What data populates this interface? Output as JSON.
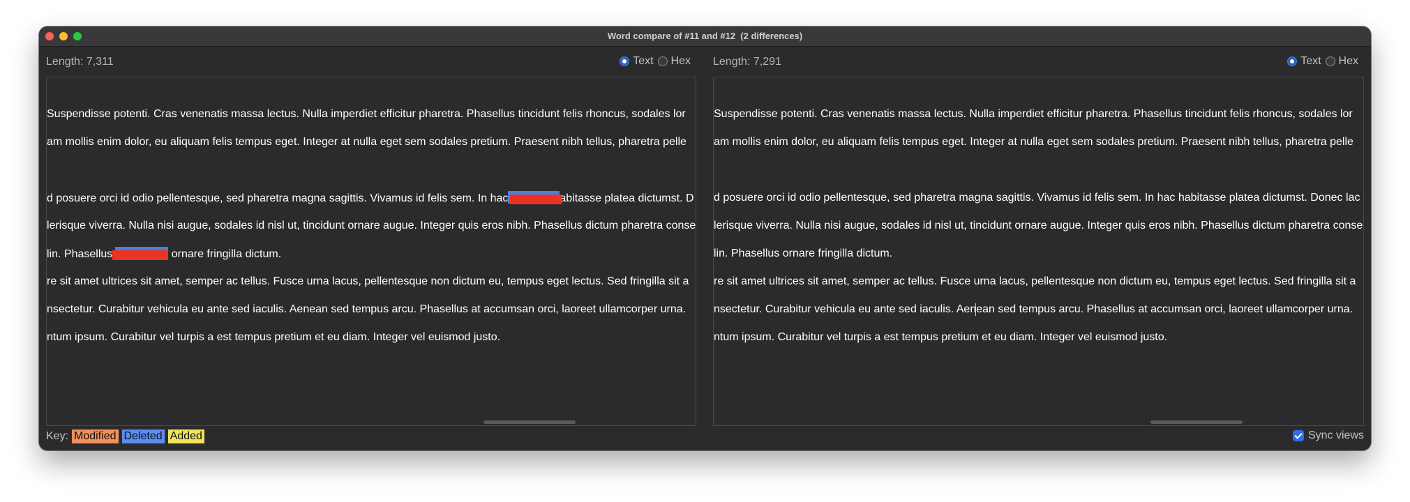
{
  "window": {
    "title": "Word compare of #11 and #12  (2 differences)"
  },
  "left_pane": {
    "length": "Length: 7,311",
    "view_modes": [
      "Text",
      "Hex"
    ],
    "selected_mode": "Text",
    "lines": [
      "Suspendisse potenti. Cras venenatis massa lectus. Nulla imperdiet efficitur pharetra. Phasellus tincidunt felis rhoncus, sodales lor",
      "am mollis enim dolor, eu aliquam felis tempus eget. Integer at nulla eget sem sodales pretium. Praesent nibh tellus, pharetra pelle",
      "",
      "d posuere orci id odio pellentesque, sed pharetra magna sagittis. Vivamus id felis sem. In hac",
      "lerisque viverra. Nulla nisi augue, sodales id nisl ut, tincidunt ornare augue. Integer quis eros nibh. Phasellus dictum pharetra conse",
      "lin. Phasellus",
      "re sit amet ultrices sit amet, semper ac tellus. Fusce urna lacus, pellentesque non dictum eu, tempus eget lectus. Sed fringilla sit a",
      "nsectetur. Curabitur vehicula eu ante sed iaculis. Aenean sed tempus arcu. Phasellus at accumsan orci, laoreet ullamcorper urna.",
      "ntum ipsum. Curabitur vel turpis a est tempus pretium et eu diam. Integer vel euismod justo."
    ],
    "line4_tail": "abitasse platea dictumst. D",
    "line6_tail": "ornare fringilla dictum."
  },
  "right_pane": {
    "length": "Length: 7,291",
    "view_modes": [
      "Text",
      "Hex"
    ],
    "selected_mode": "Text",
    "lines": [
      "Suspendisse potenti. Cras venenatis massa lectus. Nulla imperdiet efficitur pharetra. Phasellus tincidunt felis rhoncus, sodales lor",
      "am mollis enim dolor, eu aliquam felis tempus eget. Integer at nulla eget sem sodales pretium. Praesent nibh tellus, pharetra pelle",
      "",
      "d posuere orci id odio pellentesque, sed pharetra magna sagittis. Vivamus id felis sem. In hac habitasse platea dictumst. Donec lac",
      "lerisque viverra. Nulla nisi augue, sodales id nisl ut, tincidunt ornare augue. Integer quis eros nibh. Phasellus dictum pharetra conse",
      "lin. Phasellus ornare fringilla dictum.",
      "re sit amet ultrices sit amet, semper ac tellus. Fusce urna lacus, pellentesque non dictum eu, tempus eget lectus. Sed fringilla sit a",
      "nsectetur. Curabitur vehicula eu ante sed iaculis. Aenean sed tempus arcu. Phasellus at accumsan orci, laoreet ullamcorper urna.",
      "ntum ipsum. Curabitur vel turpis a est tempus pretium et eu diam. Integer vel euismod justo."
    ]
  },
  "footer": {
    "key_label": "Key:",
    "key_items": [
      {
        "label": "Modified",
        "color": "#f0915a"
      },
      {
        "label": "Deleted",
        "color": "#5b8ef0"
      },
      {
        "label": "Added",
        "color": "#f2e35a"
      }
    ],
    "sync_label": "Sync views",
    "sync_checked": true
  },
  "colors": {
    "window_bg": "#2b2b2d",
    "deleted_highlight": "#4a7fe0",
    "redaction": "#ea3323",
    "accent": "#2f6fe8"
  }
}
